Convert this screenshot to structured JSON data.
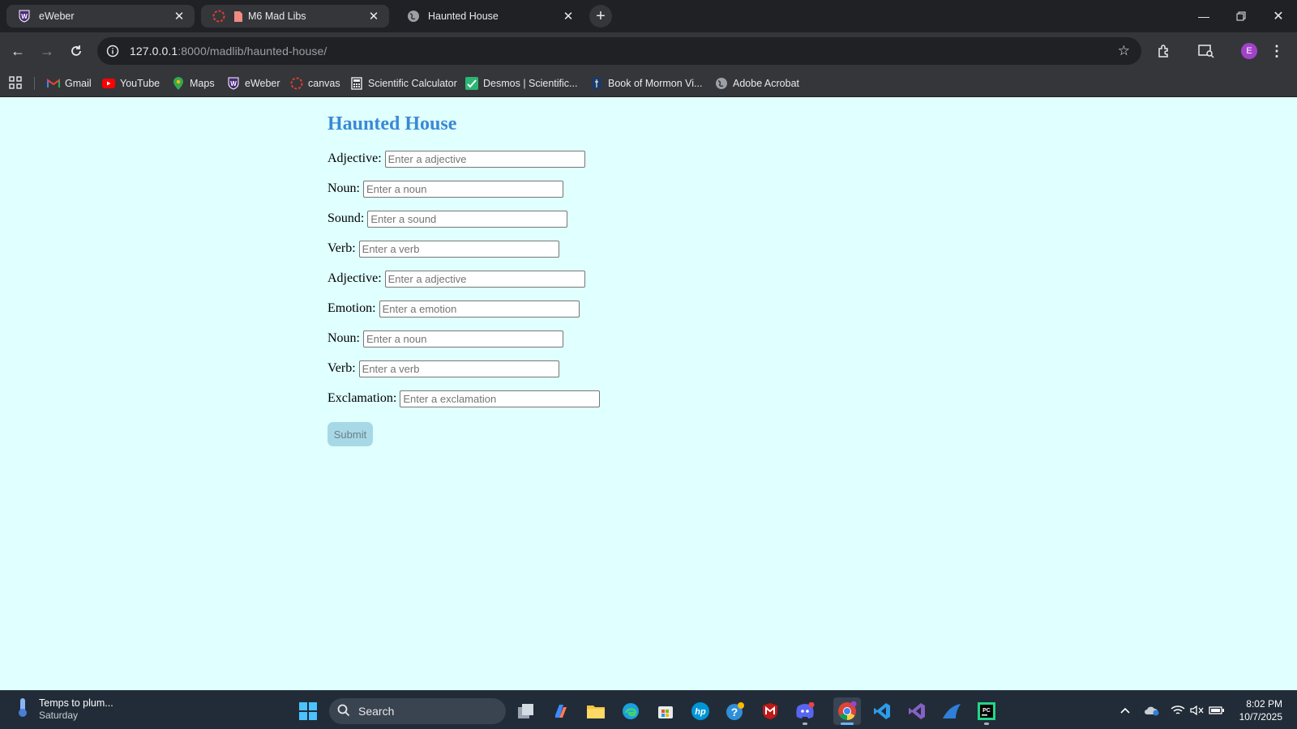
{
  "browser": {
    "tabs": [
      {
        "title": "eWeber",
        "favicon": "eweber-shield-icon"
      },
      {
        "title": "M6 Mad Libs",
        "favicon": "canvas-icon"
      },
      {
        "title": "Haunted House",
        "favicon": "globe-icon"
      }
    ],
    "url_host": "127.0.0.1",
    "url_rest": ":8000/madlib/haunted-house/",
    "profile_initial": "E",
    "bookmarks": [
      {
        "label": "Gmail",
        "icon": "gmail-icon"
      },
      {
        "label": "YouTube",
        "icon": "youtube-icon"
      },
      {
        "label": "Maps",
        "icon": "maps-icon"
      },
      {
        "label": "eWeber",
        "icon": "eweber-shield-icon"
      },
      {
        "label": "canvas",
        "icon": "canvas-icon"
      },
      {
        "label": "Scientific Calculator",
        "icon": "calculator-icon"
      },
      {
        "label": "Desmos | Scientific...",
        "icon": "desmos-icon"
      },
      {
        "label": "Book of Mormon Vi...",
        "icon": "book-icon"
      },
      {
        "label": "Adobe Acrobat",
        "icon": "globe-icon"
      }
    ]
  },
  "page": {
    "title": "Haunted House",
    "fields": [
      {
        "label": "Adjective:",
        "placeholder": "Enter a adjective"
      },
      {
        "label": "Noun:",
        "placeholder": "Enter a noun"
      },
      {
        "label": "Sound:",
        "placeholder": "Enter a sound"
      },
      {
        "label": "Verb:",
        "placeholder": "Enter a verb"
      },
      {
        "label": "Adjective:",
        "placeholder": "Enter a adjective"
      },
      {
        "label": "Emotion:",
        "placeholder": "Enter a emotion"
      },
      {
        "label": "Noun:",
        "placeholder": "Enter a noun"
      },
      {
        "label": "Verb:",
        "placeholder": "Enter a verb"
      },
      {
        "label": "Exclamation:",
        "placeholder": "Enter a exclamation"
      }
    ],
    "submit_label": "Submit",
    "colors": {
      "background": "#e0ffff",
      "heading": "#3a89d6",
      "submit_bg": "#a7d8e6"
    }
  },
  "taskbar": {
    "weather_title": "Temps to plum...",
    "weather_day": "Saturday",
    "search_label": "Search",
    "time": "8:02 PM",
    "date": "10/7/2025"
  }
}
